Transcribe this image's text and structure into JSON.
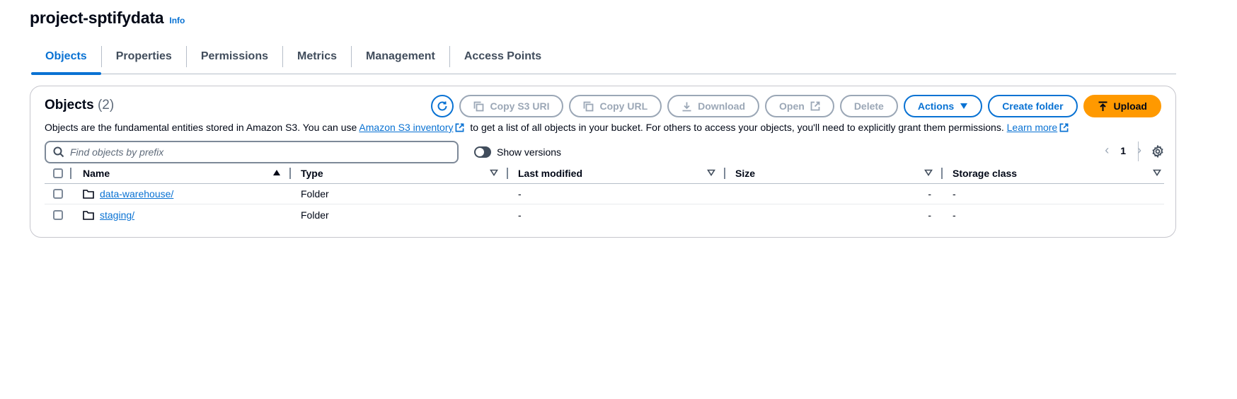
{
  "header": {
    "title": "project-sptifydata",
    "info_label": "Info"
  },
  "tabs": [
    {
      "label": "Objects",
      "active": true
    },
    {
      "label": "Properties"
    },
    {
      "label": "Permissions"
    },
    {
      "label": "Metrics"
    },
    {
      "label": "Management"
    },
    {
      "label": "Access Points"
    }
  ],
  "panel": {
    "title": "Objects",
    "count": "(2)",
    "description_prefix": "Objects are the fundamental entities stored in Amazon S3. You can use",
    "inventory_link": "Amazon S3 inventory",
    "description_middle": "to get a list of all objects in your bucket. For others to access your objects, you'll need to explicitly grant them permissions.",
    "learn_more": "Learn more"
  },
  "toolbar": {
    "copy_s3_uri": "Copy S3 URI",
    "copy_url": "Copy URL",
    "download": "Download",
    "open": "Open",
    "delete": "Delete",
    "actions": "Actions",
    "create_folder": "Create folder",
    "upload": "Upload"
  },
  "search": {
    "placeholder": "Find objects by prefix",
    "value": ""
  },
  "show_versions": {
    "label": "Show versions",
    "enabled": false
  },
  "pagination": {
    "current_page": "1"
  },
  "table": {
    "columns": [
      "Name",
      "Type",
      "Last modified",
      "Size",
      "Storage class"
    ],
    "rows": [
      {
        "name": "data-warehouse/",
        "type": "Folder",
        "last_modified": "-",
        "size": "-",
        "storage_class": "-"
      },
      {
        "name": "staging/",
        "type": "Folder",
        "last_modified": "-",
        "size": "-",
        "storage_class": "-"
      }
    ]
  },
  "colors": {
    "accent": "#0972d3",
    "primary_button": "#ff9900",
    "disabled": "#9ba7b6"
  }
}
